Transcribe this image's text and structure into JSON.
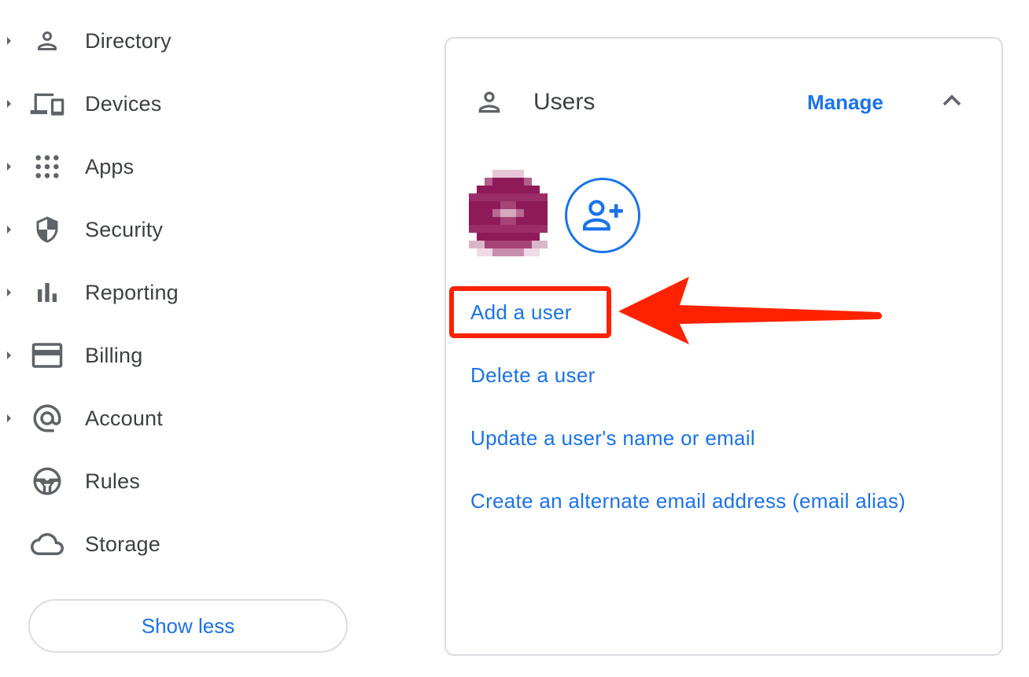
{
  "sidebar": {
    "items": [
      {
        "label": "Directory",
        "icon": "person-icon",
        "has_caret": true
      },
      {
        "label": "Devices",
        "icon": "devices-icon",
        "has_caret": true
      },
      {
        "label": "Apps",
        "icon": "apps-grid-icon",
        "has_caret": true
      },
      {
        "label": "Security",
        "icon": "shield-icon",
        "has_caret": true
      },
      {
        "label": "Reporting",
        "icon": "bar-chart-icon",
        "has_caret": true
      },
      {
        "label": "Billing",
        "icon": "credit-card-icon",
        "has_caret": true
      },
      {
        "label": "Account",
        "icon": "at-sign-icon",
        "has_caret": true
      },
      {
        "label": "Rules",
        "icon": "steering-wheel-icon",
        "has_caret": false
      },
      {
        "label": "Storage",
        "icon": "cloud-icon",
        "has_caret": false
      }
    ],
    "show_less_label": "Show less"
  },
  "users_card": {
    "title": "Users",
    "manage_label": "Manage",
    "links": [
      "Add a user",
      "Delete a user",
      "Update a user's name or email",
      "Create an alternate email address (email alias)"
    ]
  },
  "colors": {
    "link_blue": "#1a73e8",
    "text_dark": "#3c4043",
    "icon_grey": "#5f6368",
    "highlight_red": "#ff2200",
    "avatar_purple": "#8e1a5a"
  }
}
